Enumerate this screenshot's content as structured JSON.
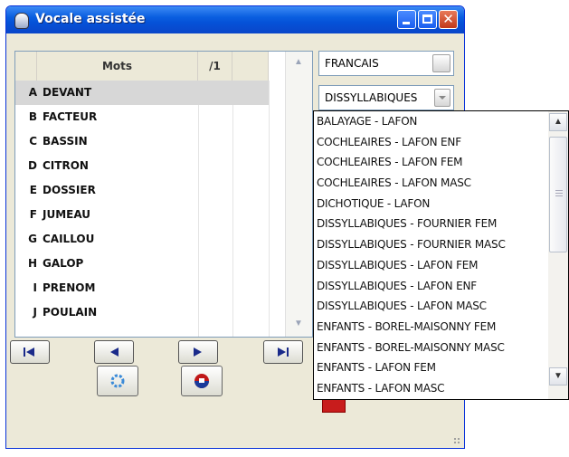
{
  "window": {
    "title": "Vocale assistée"
  },
  "table": {
    "headers": [
      "Mots",
      "/1"
    ],
    "rows": [
      {
        "letter": "A",
        "word": "DEVANT"
      },
      {
        "letter": "B",
        "word": "FACTEUR"
      },
      {
        "letter": "C",
        "word": "BASSIN"
      },
      {
        "letter": "D",
        "word": "CITRON"
      },
      {
        "letter": "E",
        "word": "DOSSIER"
      },
      {
        "letter": "F",
        "word": "JUMEAU"
      },
      {
        "letter": "G",
        "word": "CAILLOU"
      },
      {
        "letter": "H",
        "word": "GALOP"
      },
      {
        "letter": "I",
        "word": "PRENOM"
      },
      {
        "letter": "J",
        "word": "POULAIN"
      }
    ]
  },
  "language_select": {
    "value": "FRANCAIS"
  },
  "list_select": {
    "value": "DISSYLLABIQUES"
  },
  "dropdown": {
    "options": [
      "BALAYAGE - LAFON",
      "COCHLEAIRES - LAFON ENF",
      "COCHLEAIRES - LAFON FEM",
      "COCHLEAIRES - LAFON MASC",
      "DICHOTIQUE - LAFON",
      "DISSYLLABIQUES - FOURNIER FEM",
      "DISSYLLABIQUES - FOURNIER MASC",
      "DISSYLLABIQUES - LAFON  FEM",
      "DISSYLLABIQUES - LAFON ENF",
      "DISSYLLABIQUES - LAFON MASC",
      "ENFANTS - BOREL-MAISONNY FEM",
      "ENFANTS - BOREL-MAISONNY MASC",
      "ENFANTS - LAFON FEM",
      "ENFANTS - LAFON MASC"
    ]
  },
  "colors": {
    "titlebar": "#0a5ee0",
    "selected_row": "#d7d7d7",
    "close": "#c2381a"
  },
  "icons": [
    "app-icon",
    "minimize-icon",
    "maximize-icon",
    "close-icon",
    "first-icon",
    "previous-icon",
    "next-icon",
    "last-icon",
    "refresh-icon",
    "flag-icon"
  ]
}
